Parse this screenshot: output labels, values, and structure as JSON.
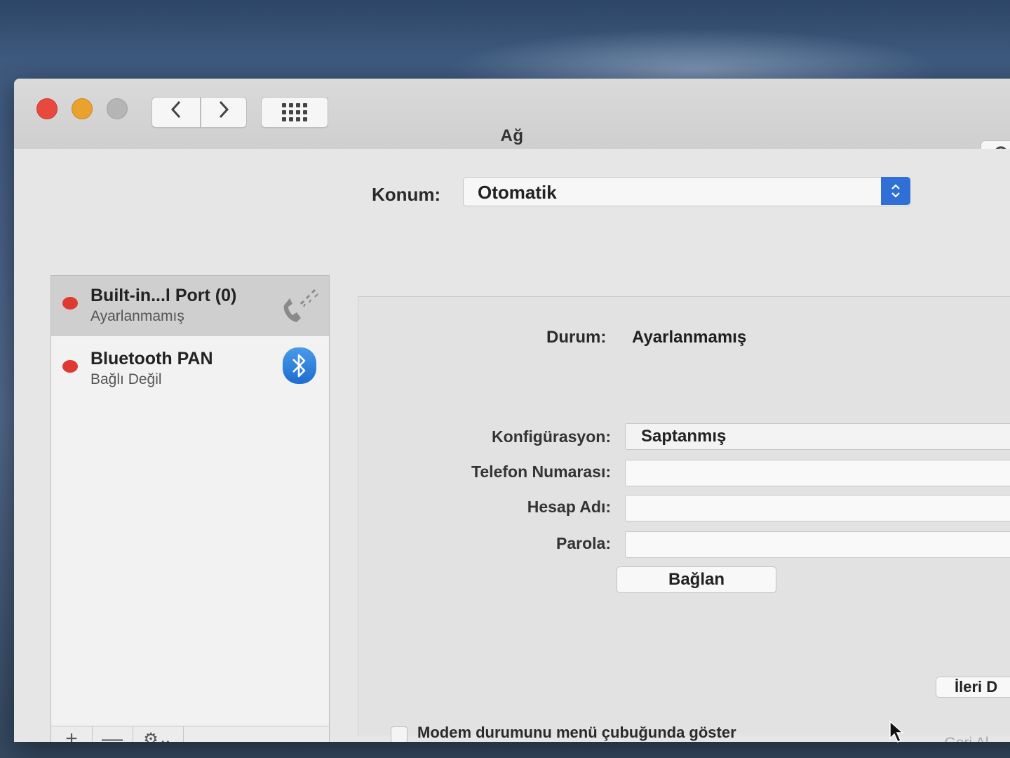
{
  "window": {
    "title": "Ağ"
  },
  "toolbar": {
    "back_icon": "chevron-left-icon",
    "forward_icon": "chevron-right-icon",
    "grid_icon": "show-all-grid-icon",
    "search_icon": "search-icon"
  },
  "location": {
    "label": "Konum:",
    "value": "Otomatik"
  },
  "sidebar": {
    "items": [
      {
        "name": "Built-in...l Port (0)",
        "status": "Ayarlanmamış",
        "status_color": "#df3a32",
        "icon": "phone-icon",
        "selected": true
      },
      {
        "name": "Bluetooth PAN",
        "status": "Bağlı Değil",
        "status_color": "#df3a32",
        "icon": "bluetooth-icon",
        "selected": false
      }
    ],
    "toolbar": {
      "add": "+",
      "remove": "—",
      "gear": "⚙⌄"
    }
  },
  "detail": {
    "status_label": "Durum:",
    "status_value": "Ayarlanmamış",
    "config_label": "Konfigürasyon:",
    "config_value": "Saptanmış",
    "phone_label": "Telefon Numarası:",
    "phone_value": "",
    "account_label": "Hesap Adı:",
    "account_value": "",
    "password_label": "Parola:",
    "password_value": "",
    "connect_button": "Bağlan",
    "modem_checkbox_label": "Modem durumunu menü çubuğunda göster",
    "modem_checked": false
  },
  "footer": {
    "advanced_button": "İleri D",
    "revert_button": "Geri Al"
  },
  "colors": {
    "accent": "#2f6fd6",
    "status_red": "#df3a32"
  }
}
